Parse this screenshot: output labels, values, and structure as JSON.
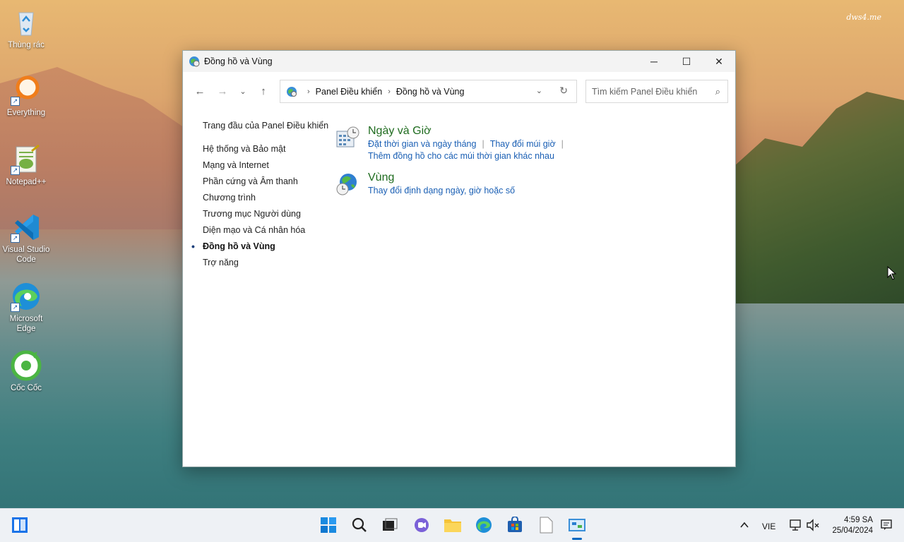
{
  "desktop": {
    "watermark": "dws4.me",
    "icons": [
      {
        "label": "Thùng rác",
        "icon": "recycle-bin-icon"
      },
      {
        "label": "Everything",
        "icon": "everything-search-icon"
      },
      {
        "label": "Notepad++",
        "icon": "notepadpp-icon"
      },
      {
        "label": "Visual Studio Code",
        "icon": "vscode-icon"
      },
      {
        "label": "Microsoft Edge",
        "icon": "edge-icon"
      },
      {
        "label": "Cốc Cốc",
        "icon": "coccoc-icon"
      }
    ]
  },
  "window": {
    "title": "Đồng hồ và Vùng",
    "breadcrumb": [
      "Panel Điều khiển",
      "Đồng hồ và Vùng"
    ],
    "search_placeholder": "Tìm kiếm Panel Điều khiển",
    "left_nav": {
      "home": "Trang đầu của Panel Điều khiển",
      "items": [
        "Hệ thống và Bảo mật",
        "Mạng và Internet",
        "Phần cứng và Âm thanh",
        "Chương trình",
        "Trương mục Người dùng",
        "Diện mạo và Cá nhân hóa",
        "Đồng hồ và Vùng",
        "Trợ năng"
      ],
      "active_index": 6
    },
    "categories": [
      {
        "title": "Ngày và Giờ",
        "links": [
          "Đặt thời gian và ngày tháng",
          "Thay đổi múi giờ",
          "Thêm đồng hồ cho các múi thời gian khác nhau"
        ],
        "icon": "date-time-icon"
      },
      {
        "title": "Vùng",
        "links": [
          "Thay đổi định dạng ngày, giờ hoặc số"
        ],
        "icon": "region-globe-icon"
      }
    ]
  },
  "taskbar": {
    "language": "VIE",
    "time": "4:59 SA",
    "date": "25/04/2024",
    "pinned": [
      "start-icon",
      "search-icon",
      "task-view-icon",
      "chat-icon",
      "file-explorer-icon",
      "edge-icon",
      "store-icon",
      "notepad-icon",
      "control-panel-icon"
    ]
  },
  "colors": {
    "category_title": "#1e6b1e",
    "link": "#1a5fb4",
    "accent": "#0067c0"
  }
}
